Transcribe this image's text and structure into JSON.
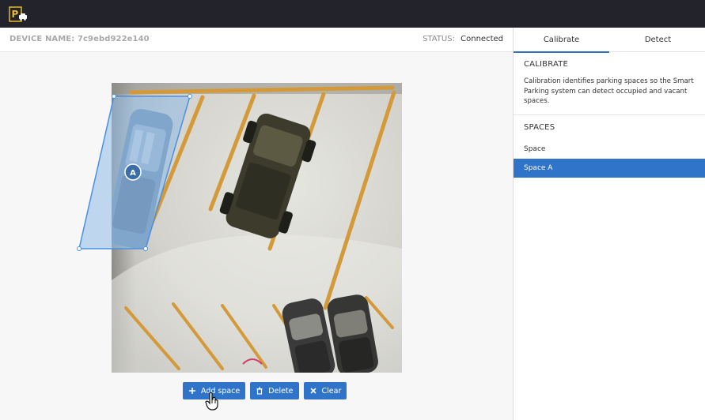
{
  "header": {
    "logo_icon": "parking-logo-icon"
  },
  "device_bar": {
    "device_label": "DEVICE NAME:",
    "device_value": "7c9ebd922e140",
    "status_label": "STATUS:",
    "status_value": "Connected"
  },
  "camera": {
    "region_marker": "A"
  },
  "actions": {
    "add_label": "Add space",
    "delete_label": "Delete",
    "clear_label": "Clear"
  },
  "sidebar": {
    "tabs": [
      {
        "label": "Calibrate",
        "active": true
      },
      {
        "label": "Detect",
        "active": false
      }
    ],
    "calibrate_title": "CALIBRATE",
    "calibrate_desc": "Calibration identifies parking spaces so the Smart Parking system can detect occupied and vacant spaces.",
    "spaces_title": "SPACES",
    "spaces": [
      {
        "label": "Space",
        "selected": false
      },
      {
        "label": "Space A",
        "selected": true
      }
    ]
  },
  "colors": {
    "accent": "#2f74c9",
    "topbar": "#23242b",
    "logo": "#e8b82a"
  }
}
